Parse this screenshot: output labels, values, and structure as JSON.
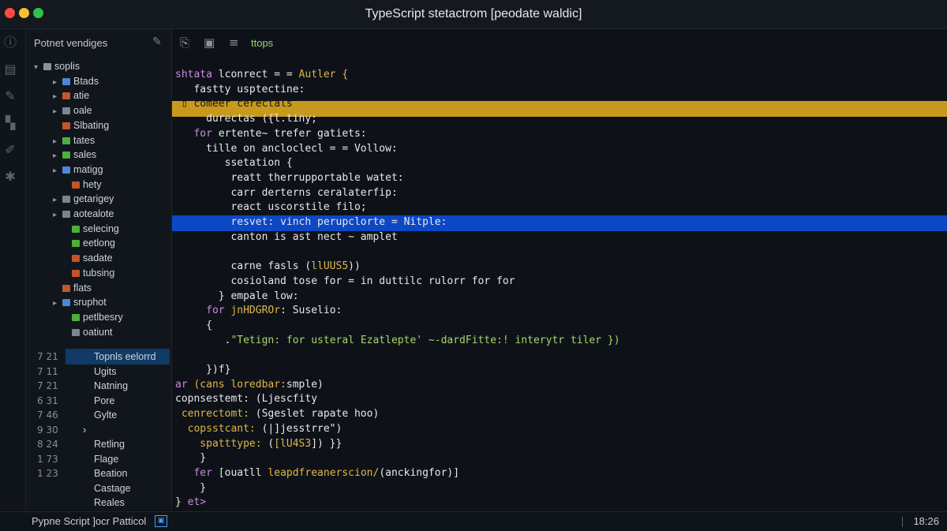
{
  "window": {
    "title": "TypeScript stetactrom [peodate waldic]"
  },
  "activity_bar": {
    "icons": [
      "info-icon",
      "layers-icon",
      "pen-icon",
      "extensions-icon",
      "brush-icon",
      "wrench-icon"
    ]
  },
  "sidebar": {
    "header": "Potnet vendiges",
    "tree": [
      {
        "label": "soplis",
        "indent": 0,
        "chevron": "▾",
        "color": "#8a939c"
      },
      {
        "label": "Btads",
        "indent": 2,
        "chevron": "▸",
        "color": "#4e86d9"
      },
      {
        "label": "atie",
        "indent": 2,
        "chevron": "▸",
        "color": "#c2552b"
      },
      {
        "label": "oale",
        "indent": 2,
        "chevron": "▸",
        "color": "#7b8590"
      },
      {
        "label": "Slbating",
        "indent": 2,
        "chevron": "",
        "color": "#c2552b"
      },
      {
        "label": "tates",
        "indent": 2,
        "chevron": "▸",
        "color": "#4fae3c"
      },
      {
        "label": "sales",
        "indent": 2,
        "chevron": "▸",
        "color": "#4fae3c"
      },
      {
        "label": "matigg",
        "indent": 2,
        "chevron": "▸",
        "color": "#4e86d9"
      },
      {
        "label": "hety",
        "indent": 3,
        "chevron": "",
        "color": "#c2552b"
      },
      {
        "label": "getarigey",
        "indent": 2,
        "chevron": "▸",
        "color": "#7b8590"
      },
      {
        "label": "aotealote",
        "indent": 2,
        "chevron": "▸",
        "color": "#7b8590"
      },
      {
        "label": "selecing",
        "indent": 3,
        "chevron": "",
        "color": "#4fae3c"
      },
      {
        "label": "eetlong",
        "indent": 3,
        "chevron": "",
        "color": "#4fae3c"
      },
      {
        "label": "sadate",
        "indent": 3,
        "chevron": "",
        "color": "#c2552b"
      },
      {
        "label": "tubsing",
        "indent": 3,
        "chevron": "",
        "color": "#c2552b"
      },
      {
        "label": "flats",
        "indent": 2,
        "chevron": "",
        "color": "#c2552b"
      },
      {
        "label": "sruphot",
        "indent": 2,
        "chevron": "▸",
        "color": "#4e86d9"
      },
      {
        "label": "petlbesry",
        "indent": 3,
        "chevron": "",
        "color": "#4fae3c"
      },
      {
        "label": "oatiunt",
        "indent": 3,
        "chevron": "",
        "color": "#7b8590"
      }
    ],
    "outline": [
      {
        "ln": "7 21",
        "label": "Topnls eelorrd",
        "selected": true
      },
      {
        "ln": "7 11",
        "label": "Ugits"
      },
      {
        "ln": "7 21",
        "label": "Natning"
      },
      {
        "ln": "6 31",
        "label": "Pore"
      },
      {
        "ln": "7 46",
        "label": "Gylte"
      },
      {
        "ln": "9 30",
        "label": "›"
      },
      {
        "ln": "8 24",
        "label": "Retling"
      },
      {
        "ln": "1 73",
        "label": "Flage"
      },
      {
        "ln": "1 23",
        "label": "Beation"
      },
      {
        "ln": "",
        "label": "Castage"
      },
      {
        "ln": "",
        "label": "Reales"
      }
    ]
  },
  "editor": {
    "toolbar_label": "ttops",
    "lines": [
      [
        {
          "t": "shtata ",
          "c": "kw"
        },
        {
          "t": "lconrect = = ",
          "c": "wt"
        },
        {
          "t": "Autler {",
          "c": "yl"
        }
      ],
      [
        {
          "t": "   fastty ",
          "c": "wt"
        },
        {
          "t": "usptectine:",
          "c": "wt"
        }
      ],
      [
        {
          "t": " ▯ comeer ",
          "c": "dk"
        },
        {
          "t": "cerectals",
          "c": "dk"
        }
      ],
      [
        {
          "t": "     durectas ({l.tiny;",
          "c": "wt"
        }
      ],
      [
        {
          "t": "   for ",
          "c": "kw"
        },
        {
          "t": "ertente~ trefer gatiets:",
          "c": "wt"
        }
      ],
      [
        {
          "t": "     tille ",
          "c": "wt"
        },
        {
          "t": "on ancloclecl = = Vollow:",
          "c": "wt"
        }
      ],
      [
        {
          "t": "        ssetation {",
          "c": "wt"
        }
      ],
      [
        {
          "t": "         reatt ",
          "c": "wt"
        },
        {
          "t": "therrupportable watet:",
          "c": "wt"
        }
      ],
      [
        {
          "t": "         carr ",
          "c": "wt"
        },
        {
          "t": "derterns ceralaterfip:",
          "c": "wt"
        }
      ],
      [
        {
          "t": "         react ",
          "c": "wt"
        },
        {
          "t": "uscorstile filo;",
          "c": "wt"
        }
      ],
      [
        {
          "t": "         resvet: ",
          "c": "wt"
        },
        {
          "t": "vinch perupclorte = Nitple:",
          "c": "wt"
        }
      ],
      [
        {
          "t": "         canton ",
          "c": "wt"
        },
        {
          "t": "is ast nect ~ amplet",
          "c": "wt"
        }
      ],
      [
        {
          "t": "",
          "c": "wt"
        }
      ],
      [
        {
          "t": "         carne ",
          "c": "wt"
        },
        {
          "t": "fasls (",
          "c": "wt"
        },
        {
          "t": "llUUS5",
          "c": "yl"
        },
        {
          "t": "))",
          "c": "wt"
        }
      ],
      [
        {
          "t": "         cosioland ",
          "c": "wt"
        },
        {
          "t": "tose for = in duttilc rulorr for for",
          "c": "wt"
        }
      ],
      [
        {
          "t": "       } ",
          "c": "wt"
        },
        {
          "t": "empale low:",
          "c": "wt"
        }
      ],
      [
        {
          "t": "     for ",
          "c": "kw"
        },
        {
          "t": "jnHDGROr",
          "c": "yl"
        },
        {
          "t": ": Suselio:",
          "c": "wt"
        }
      ],
      [
        {
          "t": "     {",
          "c": "wt"
        }
      ],
      [
        {
          "t": "        .",
          "c": "wt"
        },
        {
          "t": "\"Tetign: ",
          "c": "gn"
        },
        {
          "t": "for usteral ",
          "c": "gn"
        },
        {
          "t": "Ezatlepte' ",
          "c": "gn"
        },
        {
          "t": "~-dardFitte:! ",
          "c": "gn"
        },
        {
          "t": "interytr tiler })",
          "c": "gn"
        }
      ],
      [
        {
          "t": "",
          "c": "wt"
        }
      ],
      [
        {
          "t": "     })f}",
          "c": "wt"
        }
      ],
      [
        {
          "t": "ar ",
          "c": "kw"
        },
        {
          "t": "(cans loredbar:",
          "c": "yl"
        },
        {
          "t": "smple)",
          "c": "wt"
        }
      ],
      [
        {
          "t": "copnsestemt: ",
          "c": "wt"
        },
        {
          "t": "(Ljescfity",
          "c": "wt"
        }
      ],
      [
        {
          "t": " cenrectomt: ",
          "c": "yl"
        },
        {
          "t": "(Sgeslet rapate hoo)",
          "c": "wt"
        }
      ],
      [
        {
          "t": "  copsstcant: ",
          "c": "yl"
        },
        {
          "t": "(|]jesstrre\")",
          "c": "wt"
        }
      ],
      [
        {
          "t": "    spatttype: ",
          "c": "yl"
        },
        {
          "t": "(",
          "c": "wt"
        },
        {
          "t": "[lU4S3",
          "c": "yl"
        },
        {
          "t": "]) }}",
          "c": "wt"
        }
      ],
      [
        {
          "t": "    }",
          "c": "wt"
        }
      ],
      [
        {
          "t": "   fer ",
          "c": "kw"
        },
        {
          "t": "[ouatll ",
          "c": "wt"
        },
        {
          "t": "leapdfreanerscion/",
          "c": "yl"
        },
        {
          "t": "(anckingfor)]",
          "c": "wt"
        }
      ],
      [
        {
          "t": "    }",
          "c": "wt"
        }
      ],
      [
        {
          "t": "} ",
          "c": "wt"
        },
        {
          "t": "et>",
          "c": "kw"
        }
      ]
    ]
  },
  "statusbar": {
    "left": "Pypne Script ]ocr Patticol",
    "right": "18:26"
  }
}
